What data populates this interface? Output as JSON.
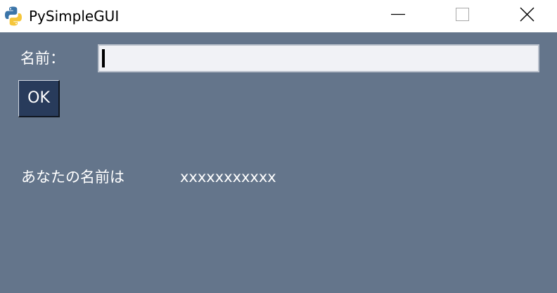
{
  "window": {
    "title": "PySimpleGUI",
    "app_icon": "python-logo-icon",
    "controls": {
      "minimize_icon": "minimize-icon",
      "maximize_icon": "maximize-icon",
      "close_icon": "close-icon"
    },
    "background_color": "#64758b"
  },
  "form": {
    "name_label": "名前：",
    "name_input_value": "",
    "ok_button_label": "OK",
    "button_color": "#283b5b"
  },
  "result": {
    "label": "あなたの名前は",
    "value": "xxxxxxxxxxx"
  }
}
